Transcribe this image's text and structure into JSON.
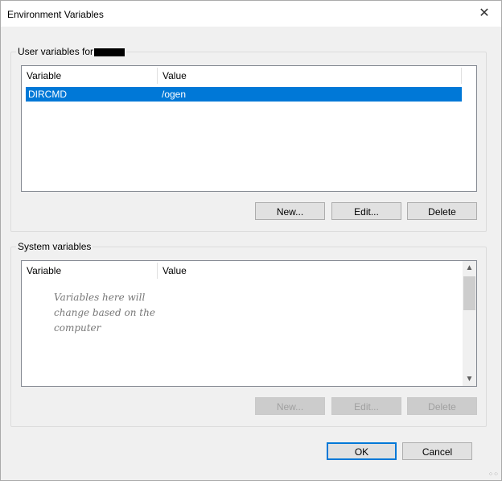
{
  "window": {
    "title": "Environment Variables",
    "close_glyph": "✕"
  },
  "user_vars": {
    "label": "User variables for",
    "columns": [
      "Variable",
      "Value"
    ],
    "rows": [
      {
        "variable": "DIRCMD",
        "value": "/ogen",
        "selected": true
      }
    ],
    "buttons": {
      "new": "New...",
      "edit": "Edit...",
      "delete": "Delete"
    }
  },
  "system_vars": {
    "label": "System variables",
    "columns": [
      "Variable",
      "Value"
    ],
    "note": "Variables here will change based on the computer",
    "buttons": {
      "new": "New...",
      "edit": "Edit...",
      "delete": "Delete",
      "disabled": true
    }
  },
  "footer": {
    "ok": "OK",
    "cancel": "Cancel"
  },
  "colors": {
    "selection": "#0078d7",
    "accent_border": "#0078d7"
  }
}
